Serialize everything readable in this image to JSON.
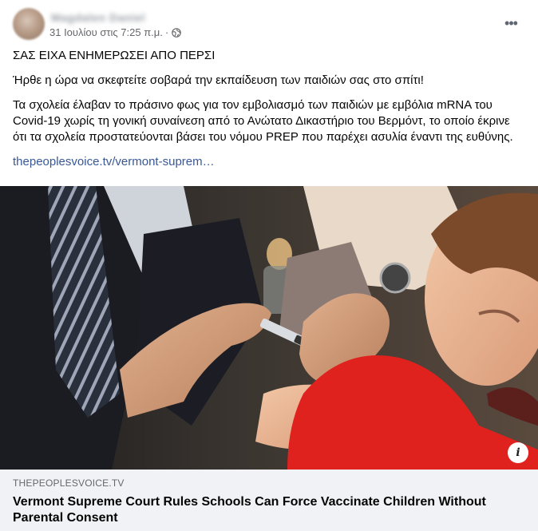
{
  "post": {
    "author": "Magdalen Daniel",
    "date": "31 Ιουλίου στις 7:25 π.μ.",
    "separator": "·",
    "privacy_icon": "globe-icon",
    "more_icon": "more-horizontal-icon",
    "paragraphs": [
      "ΣΑΣ ΕΙΧΑ ΕΝΗΜΕΡΩΣΕΙ ΑΠΟ ΠΕΡΣΙ",
      "Ήρθε η ώρα να σκεφτείτε σοβαρά την εκπαίδευση των παιδιών σας στο σπίτι!",
      "Τα σχολεία έλαβαν το πράσινο φως για τον εμβολιασμό των παιδιών με εμβόλια mRNA του Covid-19 χωρίς τη γονική συναίνεση από το Ανώτατο Δικαστήριο του Βερμόντ, το οποίο έκρινε ότι τα σχολεία προστατεύονται βάσει του νόμου PREP που παρέχει ασυλία έναντι της ευθύνης."
    ],
    "link_text": "thepeoplesvoice.tv/vermont-suprem…"
  },
  "preview": {
    "info_label": "i",
    "domain": "THEPEOPLESVOICE.TV",
    "headline": "Vermont Supreme Court Rules Schools Can Force Vaccinate Children Without Parental Consent"
  },
  "colors": {
    "link": "#385898",
    "meta": "#65676b",
    "preview_bg": "#f0f2f5",
    "shirt_red": "#e0221f"
  }
}
